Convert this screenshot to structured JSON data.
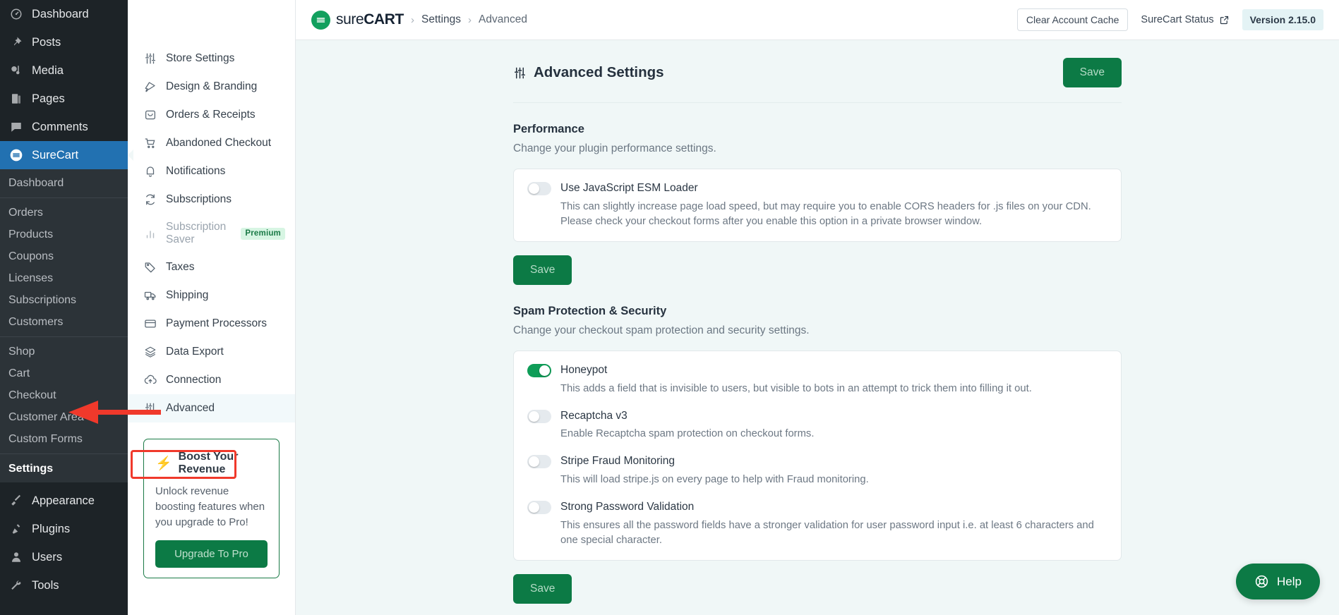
{
  "wp_sidebar": {
    "top_items": [
      {
        "label": "Dashboard",
        "icon": "dashboard-icon"
      },
      {
        "label": "Posts",
        "icon": "pin-icon"
      },
      {
        "label": "Media",
        "icon": "media-icon"
      },
      {
        "label": "Pages",
        "icon": "pages-icon"
      },
      {
        "label": "Comments",
        "icon": "comments-icon"
      }
    ],
    "active_item": {
      "label": "SureCart",
      "icon": "surecart-icon"
    },
    "sub_groups": [
      {
        "items": [
          {
            "label": "Dashboard",
            "current": false
          }
        ]
      },
      {
        "items": [
          {
            "label": "Orders",
            "current": false
          },
          {
            "label": "Products",
            "current": false
          },
          {
            "label": "Coupons",
            "current": false
          },
          {
            "label": "Licenses",
            "current": false
          },
          {
            "label": "Subscriptions",
            "current": false
          },
          {
            "label": "Customers",
            "current": false
          }
        ]
      },
      {
        "items": [
          {
            "label": "Shop",
            "current": false
          },
          {
            "label": "Cart",
            "current": false
          },
          {
            "label": "Checkout",
            "current": false
          },
          {
            "label": "Customer Area",
            "current": false
          },
          {
            "label": "Custom Forms",
            "current": false
          }
        ]
      },
      {
        "items": [
          {
            "label": "Settings",
            "current": true
          }
        ]
      }
    ],
    "bottom_items": [
      {
        "label": "Appearance",
        "icon": "brush-icon"
      },
      {
        "label": "Plugins",
        "icon": "plug-icon"
      },
      {
        "label": "Users",
        "icon": "user-icon"
      },
      {
        "label": "Tools",
        "icon": "tools-icon"
      }
    ]
  },
  "topbar": {
    "logo_text_light": "sure",
    "logo_text_bold": "CART",
    "breadcrumb": [
      "Settings",
      "Advanced"
    ],
    "clear_cache_label": "Clear Account Cache",
    "status_label": "SureCart Status",
    "version_label": "Version 2.15.0"
  },
  "settings_nav": {
    "items": [
      {
        "label": "Store Settings",
        "icon": "sliders-icon",
        "state": "normal"
      },
      {
        "label": "Design & Branding",
        "icon": "brush-tag-icon",
        "state": "normal"
      },
      {
        "label": "Orders & Receipts",
        "icon": "receipt-bag-icon",
        "state": "normal"
      },
      {
        "label": "Abandoned Checkout",
        "icon": "cart-icon",
        "state": "normal"
      },
      {
        "label": "Notifications",
        "icon": "bell-icon",
        "state": "normal"
      },
      {
        "label": "Subscriptions",
        "icon": "refresh-icon",
        "state": "normal"
      },
      {
        "label": "Subscription Saver",
        "icon": "bar-chart-icon",
        "state": "dim",
        "badge": "Premium"
      },
      {
        "label": "Taxes",
        "icon": "tag-icon",
        "state": "normal"
      },
      {
        "label": "Shipping",
        "icon": "truck-icon",
        "state": "normal"
      },
      {
        "label": "Payment Processors",
        "icon": "credit-card-icon",
        "state": "normal"
      },
      {
        "label": "Data Export",
        "icon": "layers-icon",
        "state": "normal"
      },
      {
        "label": "Connection",
        "icon": "cloud-upload-icon",
        "state": "normal"
      },
      {
        "label": "Advanced",
        "icon": "sliders-icon",
        "state": "selected"
      }
    ]
  },
  "boost_card": {
    "title": "Boost Your Revenue",
    "text": "Unlock revenue boosting features when you upgrade to Pro!",
    "button_label": "Upgrade To Pro"
  },
  "main": {
    "page_title": "Advanced Settings",
    "save_label": "Save",
    "sections": [
      {
        "title": "Performance",
        "subtitle": "Change your plugin performance settings.",
        "save_label": "Save",
        "options": [
          {
            "label": "Use JavaScript ESM Loader",
            "desc": "This can slightly increase page load speed, but may require you to enable CORS headers for .js files on your CDN. Please check your checkout forms after you enable this option in a private browser window.",
            "on": false
          }
        ]
      },
      {
        "title": "Spam Protection & Security",
        "subtitle": "Change your checkout spam protection and security settings.",
        "save_label": "Save",
        "options": [
          {
            "label": "Honeypot",
            "desc": "This adds a field that is invisible to users, but visible to bots in an attempt to trick them into filling it out.",
            "on": true
          },
          {
            "label": "Recaptcha v3",
            "desc": "Enable Recaptcha spam protection on checkout forms.",
            "on": false
          },
          {
            "label": "Stripe Fraud Monitoring",
            "desc": "This will load stripe.js on every page to help with Fraud monitoring.",
            "on": false
          },
          {
            "label": "Strong Password Validation",
            "desc": "This ensures all the password fields have a stronger validation for user password input i.e. at least 6 characters and one special character.",
            "on": false
          }
        ]
      }
    ]
  },
  "help_button": {
    "label": "Help",
    "icon": "lifebuoy-icon"
  },
  "colors": {
    "brand_green": "#0c7a45",
    "toggle_on": "#0f9d58",
    "wp_blue": "#2271b1",
    "annotation_red": "#f0392b",
    "page_bg": "#f0f7f7"
  }
}
